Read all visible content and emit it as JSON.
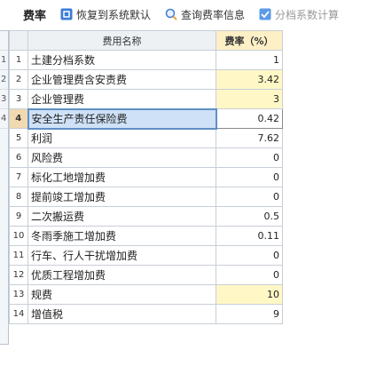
{
  "toolbar": {
    "title": "费率",
    "restore_label": "恢复到系统默认",
    "query_label": "查询费率信息",
    "tier_label": "分档系数计算",
    "tier_checked": true
  },
  "table": {
    "headers": {
      "name": "费用名称",
      "rate": "费率（%）"
    },
    "rows": [
      {
        "no": "1",
        "name": "土建分档系数",
        "rate": "1",
        "highlight": false
      },
      {
        "no": "2",
        "name": "企业管理费含安责费",
        "rate": "3.42",
        "highlight": true
      },
      {
        "no": "3",
        "name": "企业管理费",
        "rate": "3",
        "highlight": true
      },
      {
        "no": "4",
        "name": "安全生产责任保险费",
        "rate": "0.42",
        "highlight": false,
        "selected": true
      },
      {
        "no": "5",
        "name": "利润",
        "rate": "7.62",
        "highlight": false
      },
      {
        "no": "6",
        "name": "风险费",
        "rate": "0",
        "highlight": false
      },
      {
        "no": "7",
        "name": "标化工地增加费",
        "rate": "0",
        "highlight": false
      },
      {
        "no": "8",
        "name": "提前竣工增加费",
        "rate": "0",
        "highlight": false
      },
      {
        "no": "9",
        "name": "二次搬运费",
        "rate": "0.5",
        "highlight": false
      },
      {
        "no": "10",
        "name": "冬雨季施工增加费",
        "rate": "0.11",
        "highlight": false
      },
      {
        "no": "11",
        "name": "行车、行人干扰增加费",
        "rate": "0",
        "highlight": false
      },
      {
        "no": "12",
        "name": "优质工程增加费",
        "rate": "0",
        "highlight": false
      },
      {
        "no": "13",
        "name": "规费",
        "rate": "10",
        "highlight": true
      },
      {
        "no": "14",
        "name": "增值税",
        "rate": "9",
        "highlight": false
      }
    ]
  },
  "colors": {
    "accent": "#3b7dd8",
    "highlight": "#fff8c6",
    "selection": "#cfe1f7"
  }
}
